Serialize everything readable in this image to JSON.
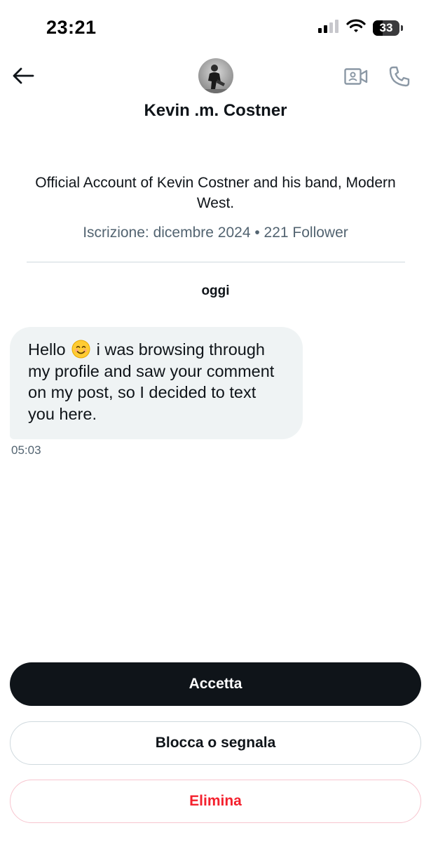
{
  "status_bar": {
    "time": "23:21",
    "battery": "33"
  },
  "header": {
    "name": "Kevin .m. Costner"
  },
  "profile": {
    "bio": "Official Account of Kevin Costner and his band, Modern West.",
    "meta": "Iscrizione: dicembre 2024 • 221 Follower"
  },
  "conversation": {
    "day_label": "oggi",
    "messages": [
      {
        "text_before_emoji": "Hello ",
        "emoji": "smiling-face",
        "text_after_emoji": " i was browsing through my profile and saw your comment on my post, so I decided to text you here.",
        "time": "05:03"
      }
    ]
  },
  "actions": {
    "accept_label": "Accetta",
    "block_label": "Blocca o segnala",
    "delete_label": "Elimina"
  },
  "colors": {
    "primary_text": "#0f1419",
    "secondary_text": "#536471",
    "bubble_bg": "#eff3f4",
    "danger": "#f4212e",
    "icon_gray": "#8b98a5"
  }
}
